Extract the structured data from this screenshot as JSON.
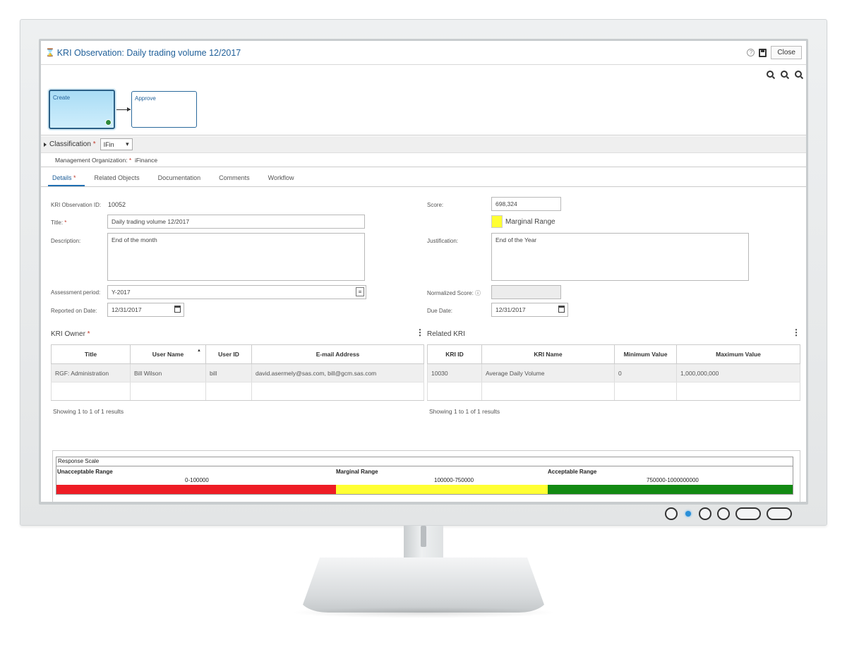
{
  "window": {
    "title": "KRI Observation: Daily trading volume 12/2017",
    "close_label": "Close"
  },
  "workflow": {
    "nodes": [
      {
        "label": "Create",
        "state": "current"
      },
      {
        "label": "Approve",
        "state": "pending"
      }
    ]
  },
  "classification": {
    "label": "Classification",
    "value": "IFin",
    "management_label": "Management Organization:",
    "management_value": "iFinance"
  },
  "tabs": [
    {
      "label": "Details",
      "active": true,
      "required": true
    },
    {
      "label": "Related Objects"
    },
    {
      "label": "Documentation"
    },
    {
      "label": "Comments"
    },
    {
      "label": "Workflow"
    }
  ],
  "details": {
    "id_label": "KRI Observation ID:",
    "id_value": "10052",
    "title_label": "Title:",
    "title_value": "Daily trading volume 12/2017",
    "description_label": "Description:",
    "description_value": "End of the month",
    "assessment_label": "Assessment period:",
    "assessment_value": "Y-2017",
    "reported_label": "Reported on Date:",
    "reported_value": "12/31/2017",
    "score_label": "Score:",
    "score_value": "698,324",
    "score_range": "Marginal Range",
    "justification_label": "Justification:",
    "justification_value": "End of the Year",
    "normalized_label": "Normalized Score:",
    "normalized_value": "",
    "due_label": "Due Date:",
    "due_value": "12/31/2017"
  },
  "kri_owner": {
    "title": "KRI Owner",
    "columns": [
      "Title",
      "User Name",
      "User ID",
      "E-mail Address"
    ],
    "rows": [
      [
        "RGF: Administration",
        "Bill Wilson",
        "bill",
        "david.asermely@sas.com, bill@gcm.sas.com"
      ]
    ],
    "footer": "Showing 1 to 1 of 1 results"
  },
  "related_kri": {
    "title": "Related KRI",
    "columns": [
      "KRI ID",
      "KRI Name",
      "Minimum Value",
      "Maximum Value"
    ],
    "rows": [
      [
        "10030",
        "Average Daily Volume",
        "0",
        "1,000,000,000"
      ]
    ],
    "footer": "Showing 1 to 1 of 1 results"
  },
  "response_scale": {
    "title": "Response Scale",
    "ranges": [
      {
        "label": "Unacceptable Range",
        "range": "0-100000",
        "color": "#ee1c25"
      },
      {
        "label": "Marginal Range",
        "range": "100000-750000",
        "color": "#ffff33"
      },
      {
        "label": "Acceptable Range",
        "range": "750000-1000000000",
        "color": "#138a13"
      }
    ]
  },
  "colors": {
    "accent": "#1f6fb2",
    "required": "#c0392b",
    "score_swatch": "#ffff33"
  }
}
